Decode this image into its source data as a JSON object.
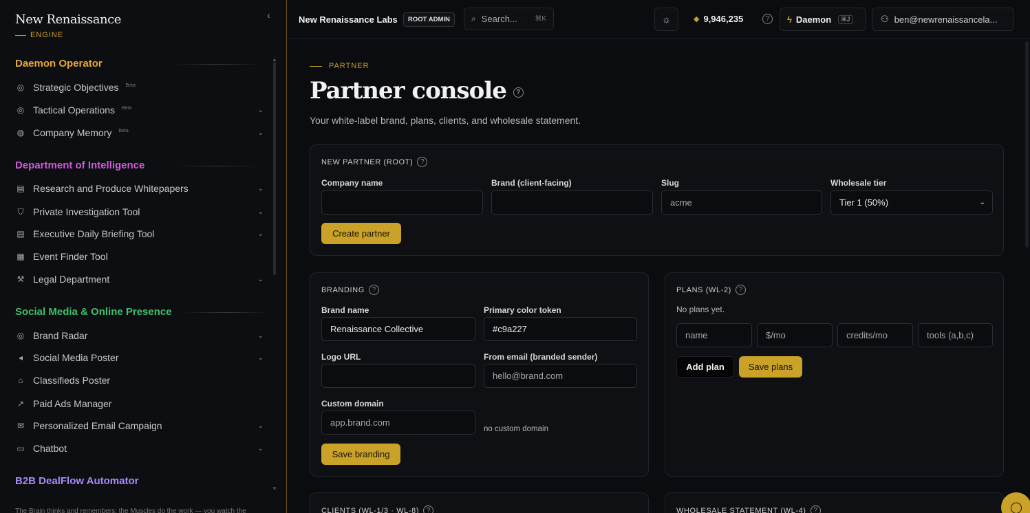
{
  "sidebar": {
    "brand_name": "New Renaissance",
    "brand_sub": "ENGINE",
    "collapse": "‹",
    "sections": [
      {
        "title": "Daemon Operator",
        "color": "#e8a838"
      },
      {
        "title": "Department of Intelligence",
        "color": "#d05ad8"
      },
      {
        "title": "Social Media & Online Presence",
        "color": "#3fbf6a"
      },
      {
        "title": "B2B DealFlow Automator",
        "color": "#a78bfa"
      }
    ],
    "items": [
      {
        "label": "Strategic Objectives",
        "beta": "Beta",
        "icon": "◎"
      },
      {
        "label": "Tactical Operations",
        "beta": "Beta",
        "icon": "◎"
      },
      {
        "label": "Company Memory",
        "beta": "Beta",
        "icon": "◍"
      },
      {
        "label": "Research and Produce Whitepapers",
        "icon": "▤"
      },
      {
        "label": "Private Investigation Tool",
        "icon": "⛉"
      },
      {
        "label": "Executive Daily Briefing Tool",
        "icon": "▤"
      },
      {
        "label": "Event Finder Tool",
        "icon": "▦"
      },
      {
        "label": "Legal Department",
        "icon": "⚒"
      },
      {
        "label": "Brand Radar",
        "icon": "◎"
      },
      {
        "label": "Social Media Poster",
        "icon": "◂"
      },
      {
        "label": "Classifieds Poster",
        "icon": "⌂"
      },
      {
        "label": "Paid Ads Manager",
        "icon": "↗"
      },
      {
        "label": "Personalized Email Campaign",
        "icon": "✉"
      },
      {
        "label": "Chatbot",
        "icon": "▭"
      }
    ],
    "footer": "The Brain thinks and remembers; the Muscles do the work — you watch the"
  },
  "topbar": {
    "org_name": "New Renaissance Labs",
    "role_badge": "ROOT ADMIN",
    "search_placeholder": "Search...",
    "search_kbd": "⌘K",
    "credits": "9,946,235",
    "daemon_label": "Daemon",
    "daemon_kbd": "⌘J",
    "user_email": "ben@newrenaissancela..."
  },
  "page": {
    "eyebrow": "PARTNER",
    "title": "Partner console",
    "subtitle": "Your white-label brand, plans, clients, and wholesale statement."
  },
  "new_partner": {
    "title": "NEW PARTNER (ROOT)",
    "company_label": "Company name",
    "company_value": "",
    "brand_label": "Brand (client-facing)",
    "brand_value": "",
    "slug_label": "Slug",
    "slug_placeholder": "acme",
    "tier_label": "Wholesale tier",
    "tier_value": "Tier 1 (50%)",
    "create_button": "Create partner"
  },
  "branding": {
    "title": "BRANDING",
    "brand_name_label": "Brand name",
    "brand_name_value": "Renaissance Collective",
    "primary_color_label": "Primary color token",
    "primary_color_value": "#c9a227",
    "logo_label": "Logo URL",
    "logo_value": "",
    "from_email_label": "From email (branded sender)",
    "from_email_placeholder": "hello@brand.com",
    "domain_label": "Custom domain",
    "domain_placeholder": "app.brand.com",
    "domain_status": "no custom domain",
    "save_button": "Save branding"
  },
  "plans": {
    "title": "PLANS (WL-2)",
    "empty": "No plans yet.",
    "name_placeholder": "name",
    "price_placeholder": "$/mo",
    "credits_placeholder": "credits/mo",
    "tools_placeholder": "tools (a,b,c)",
    "add_button": "Add plan",
    "save_button": "Save plans"
  },
  "clients": {
    "title": "CLIENTS (WL-1/3 · WL-8)"
  },
  "statement": {
    "title": "WHOLESALE STATEMENT (WL-4)"
  },
  "colors": {
    "accent": "#c9a227",
    "background": "#0b0c10",
    "card": "#0f1014"
  }
}
